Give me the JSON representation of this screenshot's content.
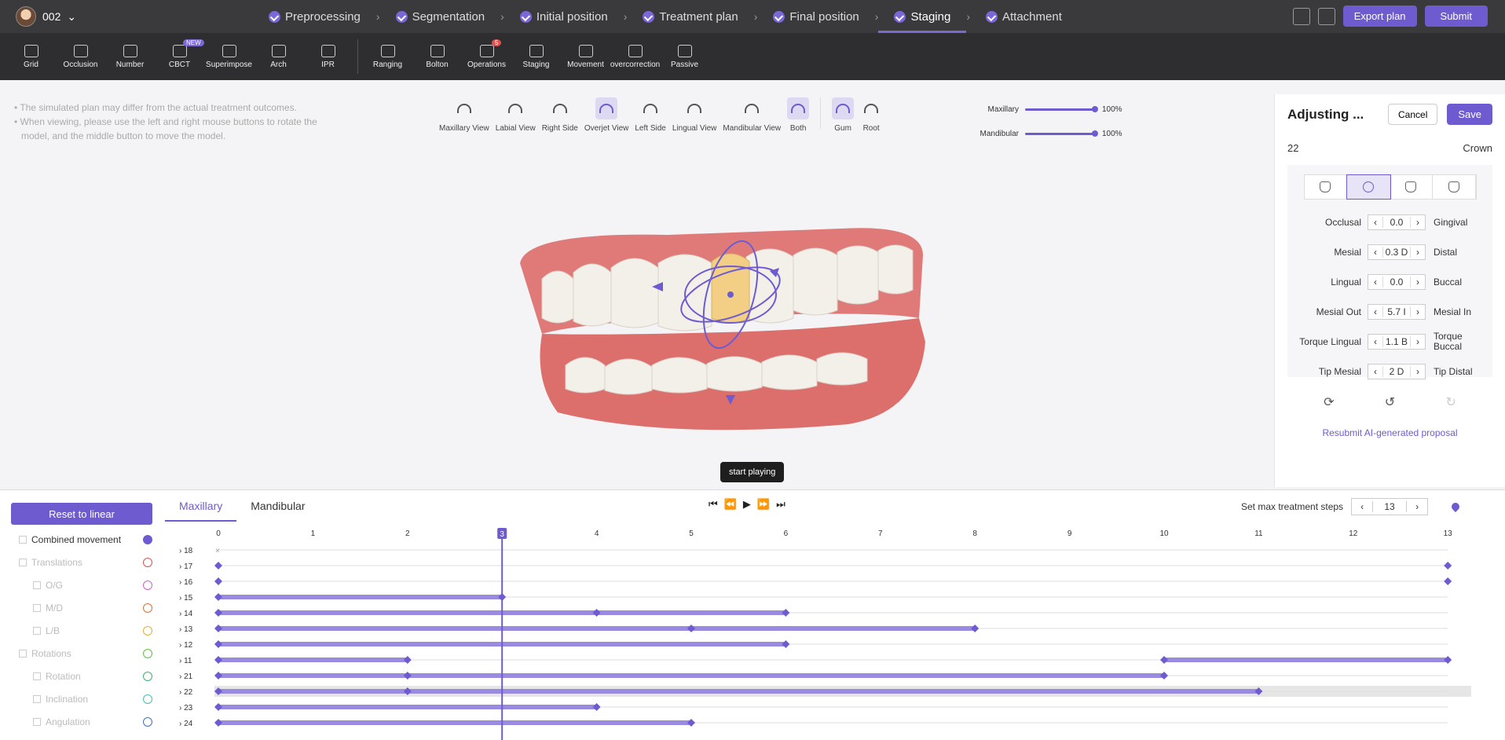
{
  "topbar": {
    "case_id": "002",
    "steps": [
      "Preprocessing",
      "Segmentation",
      "Initial position",
      "Treatment plan",
      "Final position",
      "Staging",
      "Attachment"
    ],
    "active_step": "Staging",
    "export_label": "Export plan",
    "submit_label": "Submit"
  },
  "toolbar": {
    "tools": [
      "Grid",
      "Occlusion",
      "Number",
      "CBCT",
      "Superimpose",
      "Arch",
      "IPR",
      "Ranging",
      "Bolton",
      "Operations",
      "Staging",
      "Movement",
      "overcorrection",
      "Passive"
    ],
    "cbct_badge": "NEW",
    "operations_badge": "5"
  },
  "notes": [
    "The simulated plan may differ from the actual treatment outcomes.",
    "When viewing, please use the left and right mouse buttons to rotate the model, and the middle button to move the model."
  ],
  "views": [
    "Maxillary View",
    "Labial View",
    "Right Side",
    "Overjet View",
    "Left Side",
    "Lingual View",
    "Mandibular View",
    "Both",
    "Gum",
    "Root"
  ],
  "selected_view": "Overjet View",
  "opacity": {
    "maxillary_label": "Maxillary",
    "maxillary_value": "100%",
    "mandibular_label": "Mandibular",
    "mandibular_value": "100%"
  },
  "tooltip": "start playing",
  "panel": {
    "title": "Adjusting ...",
    "cancel_label": "Cancel",
    "save_label": "Save",
    "tooth": "22",
    "mode": "Crown",
    "rows": [
      {
        "left": "Occlusal",
        "value": "0.0",
        "right": "Gingival"
      },
      {
        "left": "Mesial",
        "value": "0.3 D",
        "right": "Distal"
      },
      {
        "left": "Lingual",
        "value": "0.0",
        "right": "Buccal"
      },
      {
        "left": "Mesial Out",
        "value": "5.7 I",
        "right": "Mesial In"
      },
      {
        "left": "Torque Lingual",
        "value": "1.1 B",
        "right": "Torque Buccal"
      },
      {
        "left": "Tip Mesial",
        "value": "2 D",
        "right": "Tip Distal"
      }
    ],
    "resubmit_label": "Resubmit AI-generated proposal"
  },
  "bottom": {
    "reset_label": "Reset to linear",
    "legend": [
      {
        "label": "Combined movement",
        "color": "#6e5bd0",
        "indent": 0
      },
      {
        "label": "Translations",
        "color": "#e05050",
        "indent": 0
      },
      {
        "label": "O/G",
        "color": "#d060d0",
        "indent": 1
      },
      {
        "label": "M/D",
        "color": "#e07030",
        "indent": 1
      },
      {
        "label": "L/B",
        "color": "#e0b030",
        "indent": 1
      },
      {
        "label": "Rotations",
        "color": "#60c040",
        "indent": 0
      },
      {
        "label": "Rotation",
        "color": "#40b070",
        "indent": 1
      },
      {
        "label": "Inclination",
        "color": "#40c0b0",
        "indent": 1
      },
      {
        "label": "Angulation",
        "color": "#4070d0",
        "indent": 1
      }
    ],
    "tabs": [
      "Maxillary",
      "Mandibular"
    ],
    "max_steps_label": "Set max treatment steps",
    "max_steps_value": "13",
    "current_step": "3"
  },
  "timeline": {
    "step_labels": [
      "0",
      "1",
      "2",
      "3",
      "4",
      "5",
      "6",
      "7",
      "8",
      "9",
      "10",
      "11",
      "12",
      "13"
    ],
    "teeth": [
      {
        "id": "18",
        "bars": [],
        "keys": [],
        "missing": true
      },
      {
        "id": "17",
        "bars": [],
        "keys": [
          0,
          13
        ]
      },
      {
        "id": "16",
        "bars": [],
        "keys": [
          0,
          13
        ]
      },
      {
        "id": "15",
        "bars": [
          [
            0,
            3
          ]
        ],
        "keys": [
          0,
          3
        ]
      },
      {
        "id": "14",
        "bars": [
          [
            0,
            6
          ]
        ],
        "keys": [
          0,
          4,
          6
        ]
      },
      {
        "id": "13",
        "bars": [
          [
            0,
            8
          ]
        ],
        "keys": [
          0,
          5,
          8
        ]
      },
      {
        "id": "12",
        "bars": [
          [
            0,
            6
          ]
        ],
        "keys": [
          0,
          6
        ]
      },
      {
        "id": "11",
        "bars": [
          [
            0,
            2
          ],
          [
            10,
            13
          ]
        ],
        "keys": [
          0,
          2,
          10,
          13
        ]
      },
      {
        "id": "21",
        "bars": [
          [
            0,
            10
          ]
        ],
        "keys": [
          0,
          2,
          10
        ]
      },
      {
        "id": "22",
        "bars": [
          [
            0,
            11
          ]
        ],
        "keys": [
          0,
          2,
          11
        ],
        "selected": true
      },
      {
        "id": "23",
        "bars": [
          [
            0,
            4
          ]
        ],
        "keys": [
          0,
          4
        ]
      },
      {
        "id": "24",
        "bars": [
          [
            0,
            5
          ]
        ],
        "keys": [
          0,
          5
        ]
      }
    ]
  },
  "colors": {
    "accent": "#6e5bd0",
    "bar": "#9b8be0"
  }
}
